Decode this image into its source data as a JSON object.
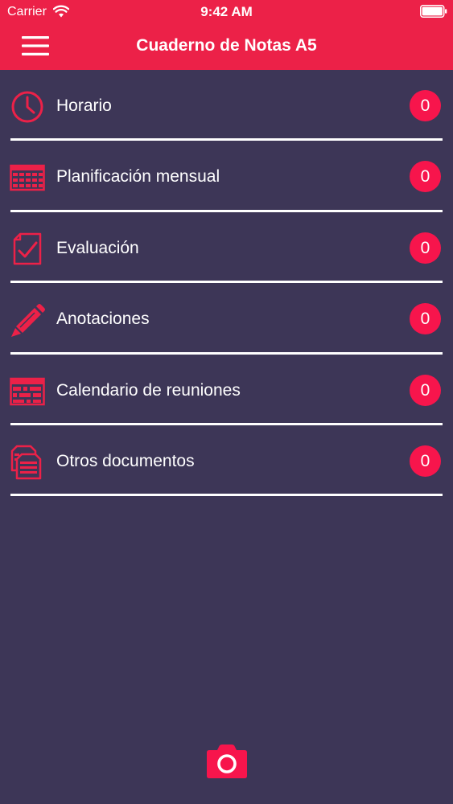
{
  "status_bar": {
    "carrier": "Carrier",
    "time": "9:42 AM"
  },
  "nav_bar": {
    "title": "Cuaderno de Notas A5"
  },
  "theme": {
    "accent": "#ec2148",
    "background": "#3d3657",
    "badge": "#f7154c",
    "text": "#ffffff"
  },
  "menu": {
    "items": [
      {
        "label": "Horario",
        "count": "0",
        "icon": "clock-icon"
      },
      {
        "label": "Planificación mensual",
        "count": "0",
        "icon": "calendar-grid-icon"
      },
      {
        "label": "Evaluación",
        "count": "0",
        "icon": "checklist-icon"
      },
      {
        "label": "Anotaciones",
        "count": "0",
        "icon": "pencil-icon"
      },
      {
        "label": "Calendario de reuniones",
        "count": "0",
        "icon": "meeting-calendar-icon"
      },
      {
        "label": "Otros documentos",
        "count": "0",
        "icon": "documents-icon"
      }
    ]
  },
  "footer": {
    "camera_icon": "camera-icon"
  }
}
